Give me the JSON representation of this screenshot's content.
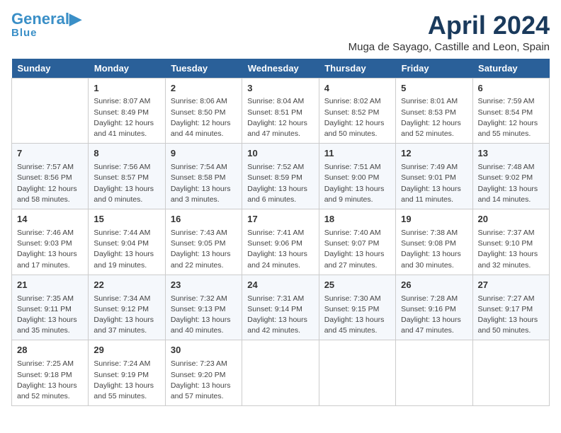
{
  "logo": {
    "general": "General",
    "blue": "Blue"
  },
  "header": {
    "month": "April 2024",
    "location": "Muga de Sayago, Castille and Leon, Spain"
  },
  "weekdays": [
    "Sunday",
    "Monday",
    "Tuesday",
    "Wednesday",
    "Thursday",
    "Friday",
    "Saturday"
  ],
  "weeks": [
    [
      {
        "day": "",
        "info": ""
      },
      {
        "day": "1",
        "info": "Sunrise: 8:07 AM\nSunset: 8:49 PM\nDaylight: 12 hours\nand 41 minutes."
      },
      {
        "day": "2",
        "info": "Sunrise: 8:06 AM\nSunset: 8:50 PM\nDaylight: 12 hours\nand 44 minutes."
      },
      {
        "day": "3",
        "info": "Sunrise: 8:04 AM\nSunset: 8:51 PM\nDaylight: 12 hours\nand 47 minutes."
      },
      {
        "day": "4",
        "info": "Sunrise: 8:02 AM\nSunset: 8:52 PM\nDaylight: 12 hours\nand 50 minutes."
      },
      {
        "day": "5",
        "info": "Sunrise: 8:01 AM\nSunset: 8:53 PM\nDaylight: 12 hours\nand 52 minutes."
      },
      {
        "day": "6",
        "info": "Sunrise: 7:59 AM\nSunset: 8:54 PM\nDaylight: 12 hours\nand 55 minutes."
      }
    ],
    [
      {
        "day": "7",
        "info": "Sunrise: 7:57 AM\nSunset: 8:56 PM\nDaylight: 12 hours\nand 58 minutes."
      },
      {
        "day": "8",
        "info": "Sunrise: 7:56 AM\nSunset: 8:57 PM\nDaylight: 13 hours\nand 0 minutes."
      },
      {
        "day": "9",
        "info": "Sunrise: 7:54 AM\nSunset: 8:58 PM\nDaylight: 13 hours\nand 3 minutes."
      },
      {
        "day": "10",
        "info": "Sunrise: 7:52 AM\nSunset: 8:59 PM\nDaylight: 13 hours\nand 6 minutes."
      },
      {
        "day": "11",
        "info": "Sunrise: 7:51 AM\nSunset: 9:00 PM\nDaylight: 13 hours\nand 9 minutes."
      },
      {
        "day": "12",
        "info": "Sunrise: 7:49 AM\nSunset: 9:01 PM\nDaylight: 13 hours\nand 11 minutes."
      },
      {
        "day": "13",
        "info": "Sunrise: 7:48 AM\nSunset: 9:02 PM\nDaylight: 13 hours\nand 14 minutes."
      }
    ],
    [
      {
        "day": "14",
        "info": "Sunrise: 7:46 AM\nSunset: 9:03 PM\nDaylight: 13 hours\nand 17 minutes."
      },
      {
        "day": "15",
        "info": "Sunrise: 7:44 AM\nSunset: 9:04 PM\nDaylight: 13 hours\nand 19 minutes."
      },
      {
        "day": "16",
        "info": "Sunrise: 7:43 AM\nSunset: 9:05 PM\nDaylight: 13 hours\nand 22 minutes."
      },
      {
        "day": "17",
        "info": "Sunrise: 7:41 AM\nSunset: 9:06 PM\nDaylight: 13 hours\nand 24 minutes."
      },
      {
        "day": "18",
        "info": "Sunrise: 7:40 AM\nSunset: 9:07 PM\nDaylight: 13 hours\nand 27 minutes."
      },
      {
        "day": "19",
        "info": "Sunrise: 7:38 AM\nSunset: 9:08 PM\nDaylight: 13 hours\nand 30 minutes."
      },
      {
        "day": "20",
        "info": "Sunrise: 7:37 AM\nSunset: 9:10 PM\nDaylight: 13 hours\nand 32 minutes."
      }
    ],
    [
      {
        "day": "21",
        "info": "Sunrise: 7:35 AM\nSunset: 9:11 PM\nDaylight: 13 hours\nand 35 minutes."
      },
      {
        "day": "22",
        "info": "Sunrise: 7:34 AM\nSunset: 9:12 PM\nDaylight: 13 hours\nand 37 minutes."
      },
      {
        "day": "23",
        "info": "Sunrise: 7:32 AM\nSunset: 9:13 PM\nDaylight: 13 hours\nand 40 minutes."
      },
      {
        "day": "24",
        "info": "Sunrise: 7:31 AM\nSunset: 9:14 PM\nDaylight: 13 hours\nand 42 minutes."
      },
      {
        "day": "25",
        "info": "Sunrise: 7:30 AM\nSunset: 9:15 PM\nDaylight: 13 hours\nand 45 minutes."
      },
      {
        "day": "26",
        "info": "Sunrise: 7:28 AM\nSunset: 9:16 PM\nDaylight: 13 hours\nand 47 minutes."
      },
      {
        "day": "27",
        "info": "Sunrise: 7:27 AM\nSunset: 9:17 PM\nDaylight: 13 hours\nand 50 minutes."
      }
    ],
    [
      {
        "day": "28",
        "info": "Sunrise: 7:25 AM\nSunset: 9:18 PM\nDaylight: 13 hours\nand 52 minutes."
      },
      {
        "day": "29",
        "info": "Sunrise: 7:24 AM\nSunset: 9:19 PM\nDaylight: 13 hours\nand 55 minutes."
      },
      {
        "day": "30",
        "info": "Sunrise: 7:23 AM\nSunset: 9:20 PM\nDaylight: 13 hours\nand 57 minutes."
      },
      {
        "day": "",
        "info": ""
      },
      {
        "day": "",
        "info": ""
      },
      {
        "day": "",
        "info": ""
      },
      {
        "day": "",
        "info": ""
      }
    ]
  ]
}
